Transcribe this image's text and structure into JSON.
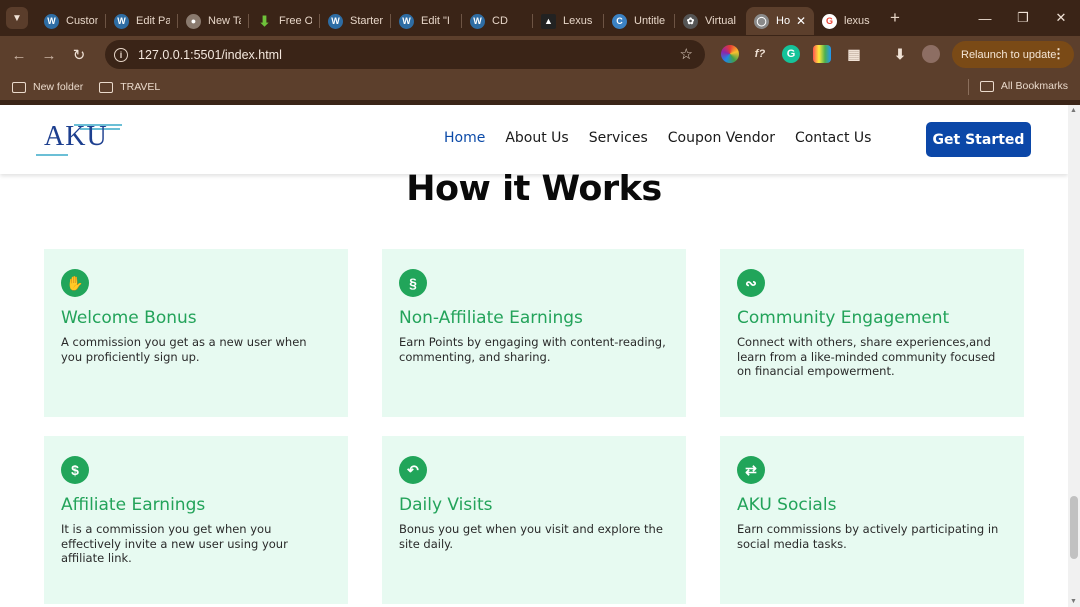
{
  "browser": {
    "tabs": [
      {
        "label": "Custon",
        "icon": "wordpress-icon",
        "color": "#2e6da4"
      },
      {
        "label": "Edit Pa",
        "icon": "wordpress-icon",
        "color": "#2e6da4"
      },
      {
        "label": "New Ta",
        "icon": "chrome-icon",
        "color": "#8a7a6e"
      },
      {
        "label": "Free O",
        "icon": "download-arrow-icon",
        "color": "#6fc23a"
      },
      {
        "label": "Starter",
        "icon": "wordpress-icon",
        "color": "#2e6da4"
      },
      {
        "label": "Edit \"I",
        "icon": "wordpress-icon",
        "color": "#2e6da4"
      },
      {
        "label": "CD",
        "icon": "wordpress-icon",
        "color": "#2e6da4"
      },
      {
        "label": "Lexus",
        "icon": "lexus-icon",
        "color": "#222222"
      },
      {
        "label": "Untitle",
        "icon": "canva-icon",
        "color": "#3b82c4"
      },
      {
        "label": "Virtual",
        "icon": "openai-icon",
        "color": "#555555"
      },
      {
        "label": "Ho",
        "icon": "globe-icon",
        "color": "#8a8a8a",
        "active": true
      },
      {
        "label": "lexus l",
        "icon": "google-icon",
        "color": "#ea4335"
      }
    ],
    "url": "127.0.0.1:5501/index.html",
    "relaunch_label": "Relaunch to update",
    "bookmarks": [
      "New folder",
      "TRAVEL"
    ],
    "all_bookmarks": "All Bookmarks"
  },
  "site": {
    "logo": "AKU",
    "nav": [
      "Home",
      "About Us",
      "Services",
      "Coupon Vendor",
      "Contact Us"
    ],
    "cta": "Get Started",
    "section_title": "How it Works",
    "accent_color": "#23a35a",
    "brand_color": "#0b47a8",
    "cards": [
      {
        "title": "Welcome Bonus",
        "desc": "A commission you get as a new user when you proficiently sign up.",
        "icon": "hand-wave-icon"
      },
      {
        "title": "Non-Affiliate Earnings",
        "desc": "Earn Points by engaging with content-reading, commenting, and sharing.",
        "icon": "coin-icon"
      },
      {
        "title": "Community Engagement",
        "desc": "Connect with others, share experiences,and learn from a like-minded community focused on financial empowerment.",
        "icon": "community-icon"
      },
      {
        "title": "Affiliate Earnings",
        "desc": "It is a commission you get when you effectively invite a new user using your affiliate link.",
        "icon": "dollar-icon"
      },
      {
        "title": "Daily Visits",
        "desc": "Bonus you get when you visit and explore the site daily.",
        "icon": "return-arrow-icon"
      },
      {
        "title": "AKU Socials",
        "desc": "Earn commissions by actively participating in social media tasks.",
        "icon": "share-icon"
      }
    ]
  }
}
